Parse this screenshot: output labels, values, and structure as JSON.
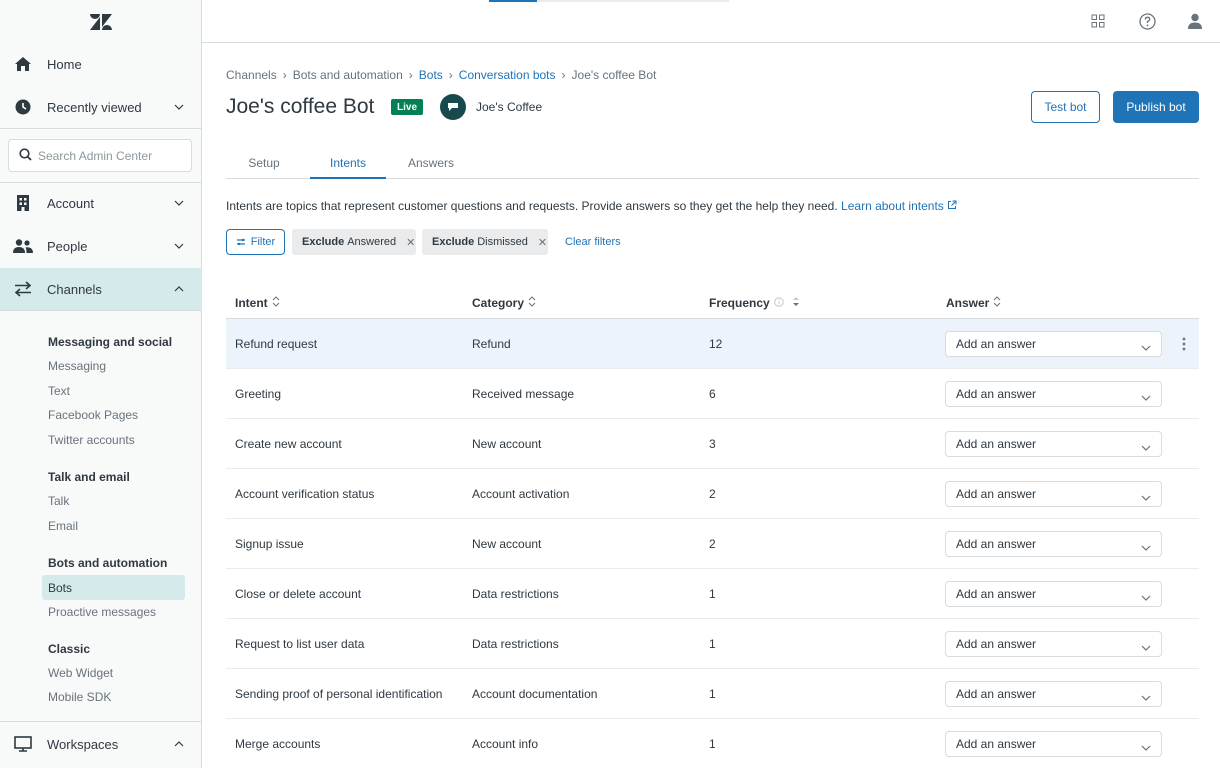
{
  "sidebar": {
    "nav": {
      "home": "Home",
      "recent": "Recently viewed",
      "account": "Account",
      "people": "People",
      "channels": "Channels",
      "workspaces": "Workspaces"
    },
    "search_placeholder": "Search Admin Center",
    "sections": [
      {
        "heading": "Messaging and social",
        "items": [
          "Messaging",
          "Text",
          "Facebook Pages",
          "Twitter accounts"
        ]
      },
      {
        "heading": "Talk and email",
        "items": [
          "Talk",
          "Email"
        ]
      },
      {
        "heading": "Bots and automation",
        "items": [
          "Bots",
          "Proactive messages"
        ]
      },
      {
        "heading": "Classic",
        "items": [
          "Web Widget",
          "Mobile SDK"
        ]
      }
    ]
  },
  "breadcrumb": {
    "channels": "Channels",
    "bots_automation": "Bots and automation",
    "bots": "Bots",
    "conversation_bots": "Conversation bots",
    "current": "Joe's coffee Bot"
  },
  "page": {
    "title": "Joe's coffee Bot",
    "status": "Live",
    "brand": "Joe's Coffee",
    "test_label": "Test bot",
    "publish_label": "Publish bot"
  },
  "tabs": [
    "Setup",
    "Intents",
    "Answers"
  ],
  "description": {
    "text": "Intents are topics that represent customer questions and requests. Provide answers so they get the help they need.",
    "link": "Learn about intents"
  },
  "filters": {
    "filter_label": "Filter",
    "chips": [
      {
        "prefix": "Exclude",
        "value": "Answered"
      },
      {
        "prefix": "Exclude",
        "value": "Dismissed"
      }
    ],
    "clear_label": "Clear filters"
  },
  "table": {
    "headers": {
      "intent": "Intent",
      "category": "Category",
      "frequency": "Frequency",
      "answer": "Answer"
    },
    "answer_placeholder": "Add an answer",
    "rows": [
      {
        "intent": "Refund request",
        "category": "Refund",
        "frequency": "12"
      },
      {
        "intent": "Greeting",
        "category": "Received message",
        "frequency": "6"
      },
      {
        "intent": "Create new account",
        "category": "New account",
        "frequency": "3"
      },
      {
        "intent": "Account verification status",
        "category": "Account activation",
        "frequency": "2"
      },
      {
        "intent": "Signup issue",
        "category": "New account",
        "frequency": "2"
      },
      {
        "intent": "Close or delete account",
        "category": "Data restrictions",
        "frequency": "1"
      },
      {
        "intent": "Request to list user data",
        "category": "Data restrictions",
        "frequency": "1"
      },
      {
        "intent": "Sending proof of personal identification",
        "category": "Account documentation",
        "frequency": "1"
      },
      {
        "intent": "Merge accounts",
        "category": "Account info",
        "frequency": "1"
      }
    ]
  }
}
